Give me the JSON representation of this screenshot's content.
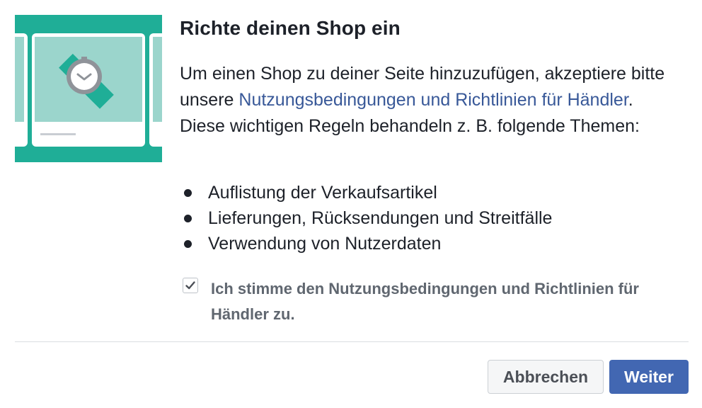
{
  "dialog": {
    "title": "Richte deinen Shop ein",
    "description": {
      "intro": "Um einen Shop zu deiner Seite hinzuzufügen, akzeptiere bitte unsere ",
      "link": "Nutzungsbedingungen und Richtlinien für Händler",
      "outro": ". Diese wichtigen Regeln behandeln z. B. folgende Themen:"
    },
    "topics": [
      "Auflistung der Verkaufsartikel",
      "Lieferungen, Rücksendungen und Streitfälle",
      "Verwendung von Nutzerdaten"
    ],
    "agreement": {
      "checked": true,
      "label": "Ich stimme den Nutzungsbedingungen und Richtlinien für Händler zu."
    },
    "buttons": {
      "cancel": "Abbrechen",
      "next": "Weiter"
    }
  },
  "colors": {
    "illustration_bg": "#1fae97",
    "illustration_card_image": "#9bd5cc",
    "link": "#385898",
    "primary_button": "#4267b2"
  },
  "icons": {
    "illustration": "watch-product-illustration",
    "checkbox": "check-icon"
  }
}
